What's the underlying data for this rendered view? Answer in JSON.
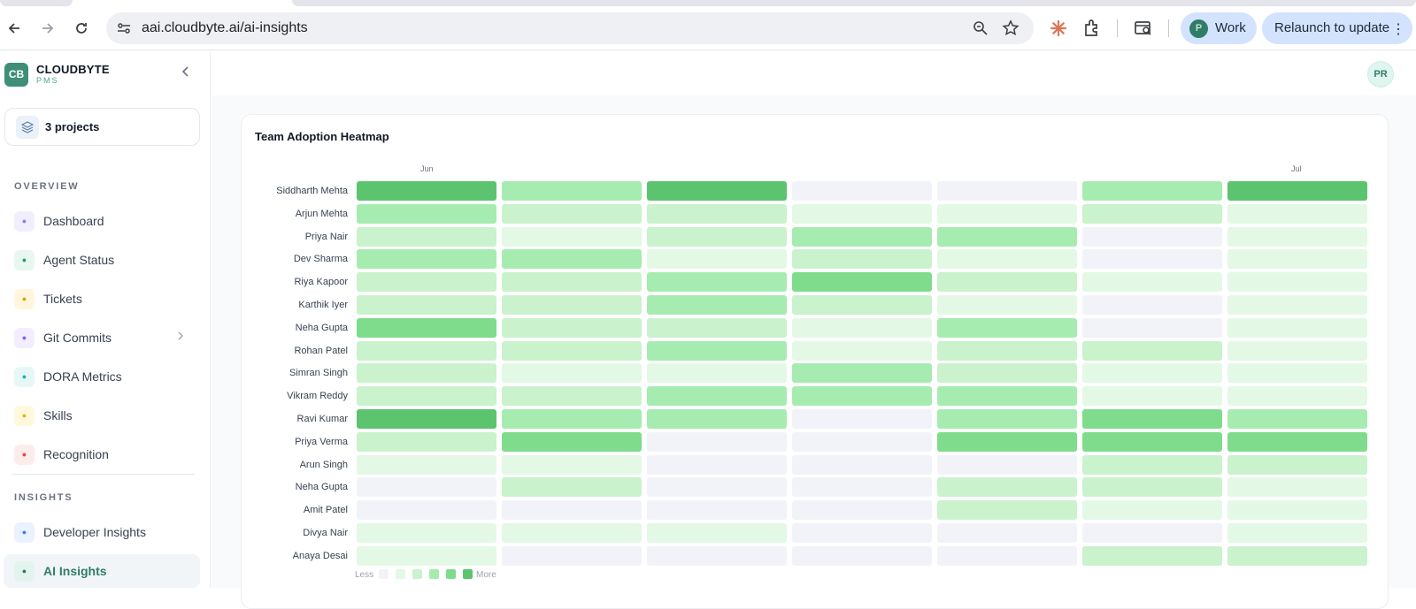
{
  "browser": {
    "url": "aai.cloudbyte.ai/ai-insights",
    "profile_initial": "P",
    "profile_label": "Work",
    "relaunch_label": "Relaunch to update",
    "kebab": "⋮"
  },
  "sidebar": {
    "brand_name": "CLOUDBYTE",
    "brand_sub": "PMS",
    "projects_label": "3 projects",
    "overview_heading": "OVERVIEW",
    "insights_heading": "INSIGHTS",
    "overview_items": [
      {
        "label": "Dashboard",
        "icon": "grid-icon",
        "color": "#8b7cf6",
        "bg": "#f1efff"
      },
      {
        "label": "Agent Status",
        "icon": "broadcast-icon",
        "color": "#22a06b",
        "bg": "#e8f7ef"
      },
      {
        "label": "Tickets",
        "icon": "ticket-icon",
        "color": "#e0a100",
        "bg": "#fff6dd"
      },
      {
        "label": "Git Commits",
        "icon": "commit-icon",
        "color": "#8b5cf6",
        "bg": "#f3eeff"
      },
      {
        "label": "DORA Metrics",
        "icon": "gauge-icon",
        "color": "#14b8a6",
        "bg": "#e6f8f6"
      },
      {
        "label": "Skills",
        "icon": "sparkles-icon",
        "color": "#eab308",
        "bg": "#fff8dc"
      },
      {
        "label": "Recognition",
        "icon": "trophy-icon",
        "color": "#ef4444",
        "bg": "#fdecec"
      }
    ],
    "insights_items": [
      {
        "label": "Developer Insights",
        "icon": "users-icon",
        "color": "#3b82f6",
        "bg": "#eaf2ff"
      },
      {
        "label": "AI Insights",
        "icon": "brain-icon",
        "color": "#2f7d69",
        "bg": "#e3f4ee"
      }
    ]
  },
  "main": {
    "user_initials": "PR",
    "card_title": "Team Adoption Heatmap",
    "months": [
      {
        "label": "Jun",
        "column": 0
      },
      {
        "label": "Jul",
        "column": 6
      }
    ],
    "legend": {
      "less": "Less",
      "more": "More"
    },
    "palette": [
      "#f1f3f8",
      "#e3f8e5",
      "#c9f2cd",
      "#a6ecb0",
      "#7fdc8c",
      "#5cc46f"
    ],
    "rows": [
      {
        "name": "Siddharth Mehta",
        "levels": [
          5,
          3,
          5,
          0,
          0,
          3,
          5
        ]
      },
      {
        "name": "Arjun Mehta",
        "levels": [
          3,
          2,
          2,
          1,
          1,
          2,
          1
        ]
      },
      {
        "name": "Priya Nair",
        "levels": [
          2,
          1,
          2,
          3,
          3,
          0,
          1
        ]
      },
      {
        "name": "Dev Sharma",
        "levels": [
          3,
          3,
          1,
          2,
          1,
          0,
          1
        ]
      },
      {
        "name": "Riya Kapoor",
        "levels": [
          2,
          2,
          3,
          4,
          2,
          1,
          1
        ]
      },
      {
        "name": "Karthik Iyer",
        "levels": [
          2,
          2,
          3,
          2,
          1,
          0,
          1
        ]
      },
      {
        "name": "Neha Gupta",
        "levels": [
          4,
          2,
          2,
          1,
          3,
          0,
          1
        ]
      },
      {
        "name": "Rohan Patel",
        "levels": [
          2,
          2,
          3,
          1,
          2,
          2,
          1
        ]
      },
      {
        "name": "Simran Singh",
        "levels": [
          2,
          1,
          1,
          3,
          2,
          1,
          1
        ]
      },
      {
        "name": "Vikram Reddy",
        "levels": [
          2,
          2,
          3,
          3,
          3,
          1,
          1
        ]
      },
      {
        "name": "Ravi Kumar",
        "levels": [
          5,
          3,
          3,
          0,
          3,
          4,
          3
        ]
      },
      {
        "name": "Priya Verma",
        "levels": [
          2,
          4,
          0,
          0,
          4,
          4,
          4
        ]
      },
      {
        "name": "Arun Singh",
        "levels": [
          1,
          1,
          0,
          0,
          0,
          2,
          2
        ]
      },
      {
        "name": "Neha Gupta",
        "levels": [
          0,
          2,
          0,
          0,
          2,
          2,
          1
        ]
      },
      {
        "name": "Amit Patel",
        "levels": [
          0,
          0,
          0,
          0,
          2,
          1,
          1
        ]
      },
      {
        "name": "Divya Nair",
        "levels": [
          1,
          1,
          1,
          0,
          0,
          0,
          1
        ]
      },
      {
        "name": "Anaya Desai",
        "levels": [
          1,
          0,
          0,
          0,
          0,
          2,
          2
        ]
      }
    ]
  }
}
